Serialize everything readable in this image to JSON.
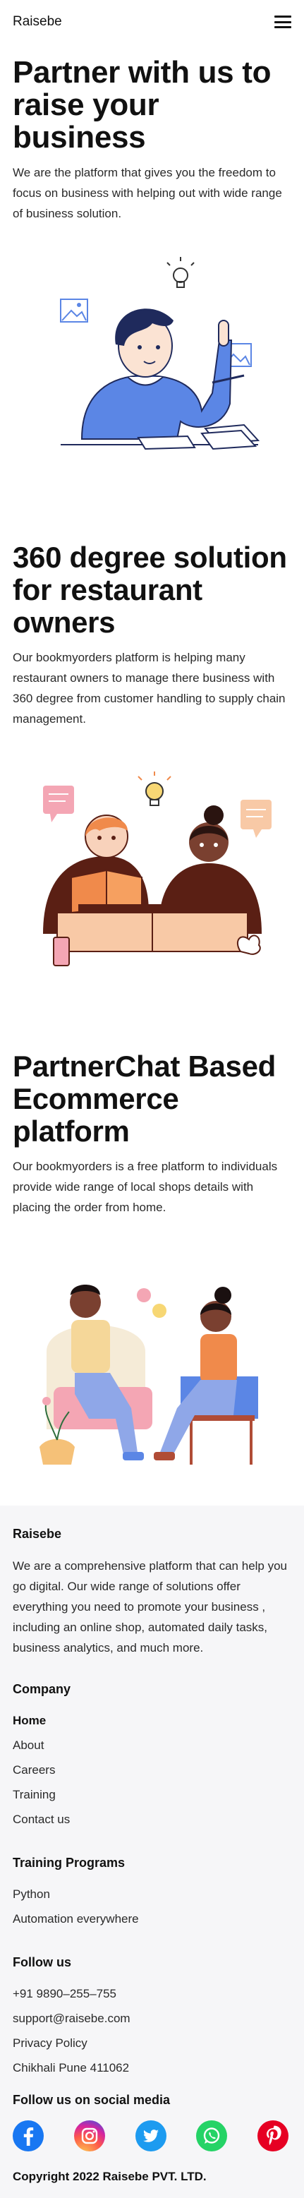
{
  "header": {
    "brand": "Raisebe",
    "menu_icon": "hamburger-menu-icon"
  },
  "hero": {
    "title": "Partner with us to raise your business",
    "text": "We are the platform that gives you the freedom to focus on business with helping out with wide range of business solution."
  },
  "solution": {
    "title": "360 degree solution for restaurant owners",
    "text": "Our bookmyorders platform is helping many restaurant owners to manage there business with 360 degree from customer handling to supply chain management."
  },
  "partnerchat": {
    "title": "PartnerChat Based Ecommerce platform",
    "text": "Our bookmyorders is a free platform to individuals provide wide range of local shops details with placing the order from home."
  },
  "footer": {
    "brand": "Raisebe",
    "about": "We are a comprehensive platform that can help you go digital. Our wide range of solutions offer everything you need to promote your business , including an online shop, automated daily tasks, business analytics, and much more.",
    "company": {
      "heading": "Company",
      "links": [
        "Home",
        "About",
        "Careers",
        "Training",
        "Contact us"
      ]
    },
    "training": {
      "heading": "Training Programs",
      "links": [
        "Python",
        "Automation everywhere"
      ]
    },
    "follow": {
      "heading": "Follow us",
      "phone": "+91 9890–255–755",
      "email": "support@raisebe.com",
      "privacy": "Privacy Policy",
      "address": "Chikhali Pune 411062"
    },
    "social": {
      "heading": "Follow us on social media",
      "icons": [
        "facebook-icon",
        "instagram-icon",
        "twitter-icon",
        "whatsapp-icon",
        "pinterest-icon"
      ]
    },
    "copyright": "Copyright 2022 Raisebe PVT. LTD."
  },
  "colors": {
    "blue_shirt": "#5b86e5",
    "dark_hair": "#1f2a5c",
    "brown_jacket": "#5a1f14",
    "orange": "#f08a4b",
    "pink": "#f4a6b4",
    "facebook": "#1877f2",
    "twitter": "#1d9bf0",
    "whatsapp": "#25d366",
    "pinterest": "#e60023"
  }
}
